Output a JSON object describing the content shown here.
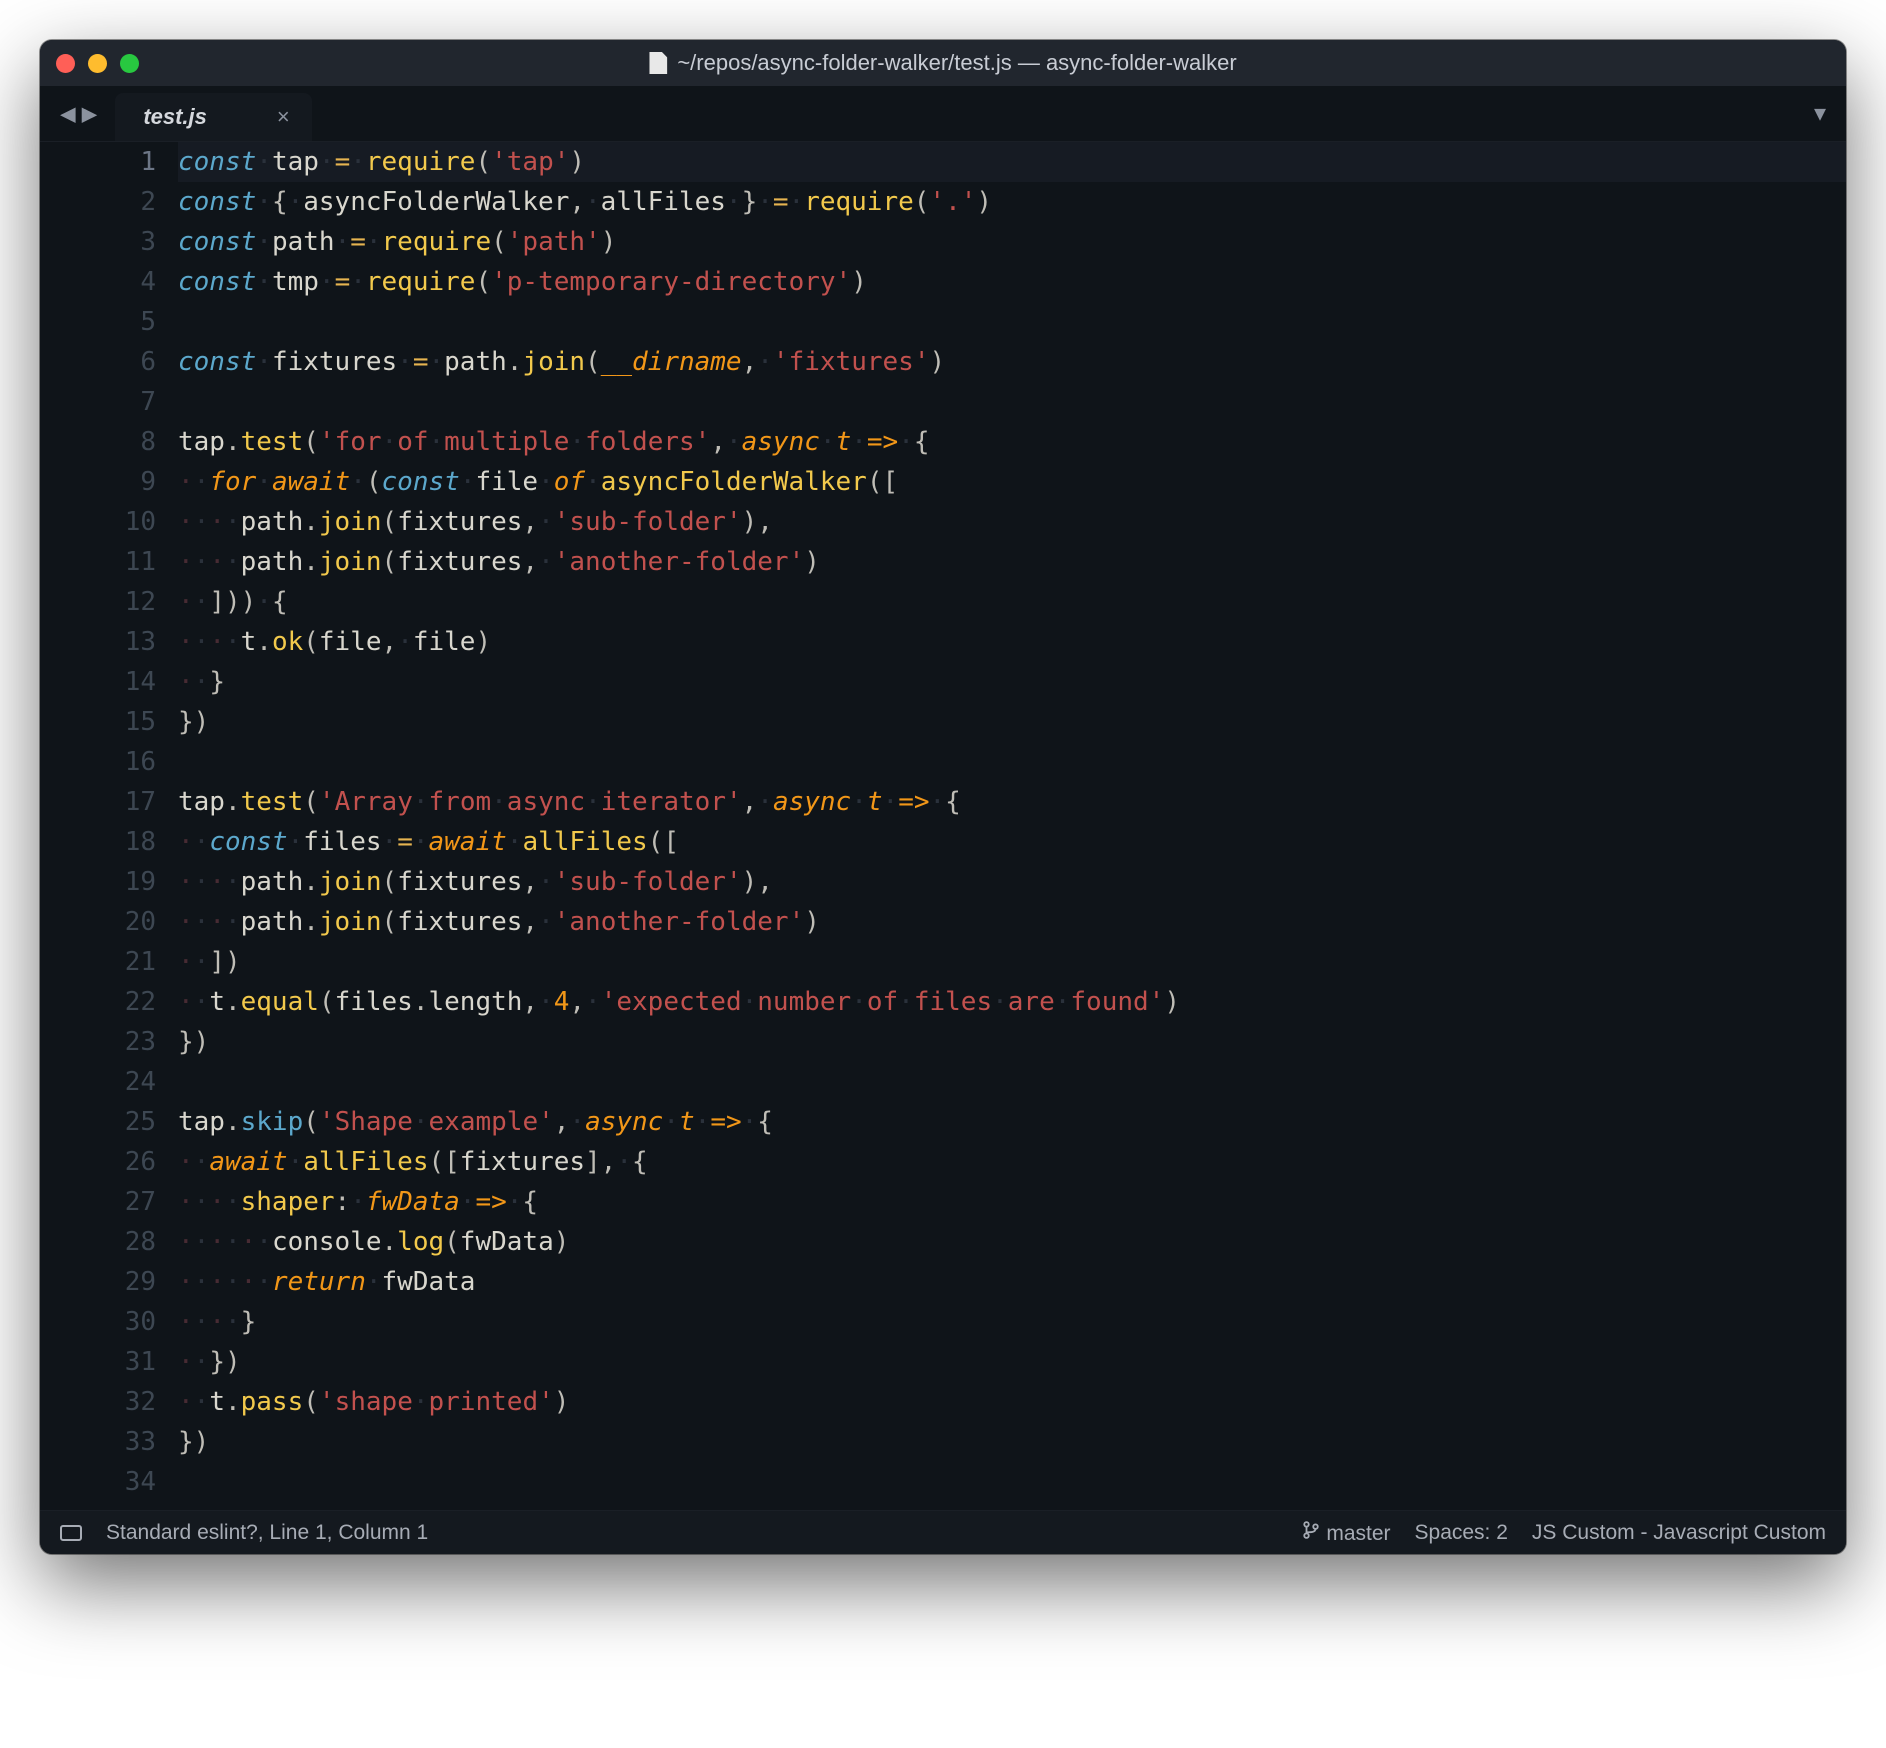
{
  "titlebar": {
    "title": "~/repos/async-folder-walker/test.js — async-folder-walker"
  },
  "tab": {
    "label": "test.js",
    "close": "×"
  },
  "nav": {
    "back": "◀",
    "forward": "▶",
    "overflow": "▼"
  },
  "code": {
    "active_line": 1,
    "lines": [
      [
        [
          "kw-decl",
          "const"
        ],
        [
          "ws",
          "·"
        ],
        [
          "ident",
          "tap"
        ],
        [
          "ws",
          "·"
        ],
        [
          "op",
          "="
        ],
        [
          "ws",
          "·"
        ],
        [
          "func",
          "require"
        ],
        [
          "punct",
          "("
        ],
        [
          "str",
          "'tap'"
        ],
        [
          "punct",
          ")"
        ]
      ],
      [
        [
          "kw-decl",
          "const"
        ],
        [
          "ws",
          "·"
        ],
        [
          "punct",
          "{"
        ],
        [
          "ws",
          "·"
        ],
        [
          "ident",
          "asyncFolderWalker"
        ],
        [
          "punct",
          ","
        ],
        [
          "ws",
          "·"
        ],
        [
          "ident",
          "allFiles"
        ],
        [
          "ws",
          "·"
        ],
        [
          "punct",
          "}"
        ],
        [
          "ws",
          "·"
        ],
        [
          "op",
          "="
        ],
        [
          "ws",
          "·"
        ],
        [
          "func",
          "require"
        ],
        [
          "punct",
          "("
        ],
        [
          "str",
          "'.'"
        ],
        [
          "punct",
          ")"
        ]
      ],
      [
        [
          "kw-decl",
          "const"
        ],
        [
          "ws",
          "·"
        ],
        [
          "ident",
          "path"
        ],
        [
          "ws",
          "·"
        ],
        [
          "op",
          "="
        ],
        [
          "ws",
          "·"
        ],
        [
          "func",
          "require"
        ],
        [
          "punct",
          "("
        ],
        [
          "str",
          "'path'"
        ],
        [
          "punct",
          ")"
        ]
      ],
      [
        [
          "kw-decl",
          "const"
        ],
        [
          "ws",
          "·"
        ],
        [
          "ident",
          "tmp"
        ],
        [
          "ws",
          "·"
        ],
        [
          "op",
          "="
        ],
        [
          "ws",
          "·"
        ],
        [
          "func",
          "require"
        ],
        [
          "punct",
          "("
        ],
        [
          "str",
          "'p-temporary-directory'"
        ],
        [
          "punct",
          ")"
        ]
      ],
      [],
      [
        [
          "kw-decl",
          "const"
        ],
        [
          "ws",
          "·"
        ],
        [
          "ident",
          "fixtures"
        ],
        [
          "ws",
          "·"
        ],
        [
          "op",
          "="
        ],
        [
          "ws",
          "·"
        ],
        [
          "ident",
          "path"
        ],
        [
          "punct",
          "."
        ],
        [
          "func",
          "join"
        ],
        [
          "punct",
          "("
        ],
        [
          "kconst",
          "__dirname"
        ],
        [
          "punct",
          ","
        ],
        [
          "ws",
          "·"
        ],
        [
          "str",
          "'fixtures'"
        ],
        [
          "punct",
          ")"
        ]
      ],
      [],
      [
        [
          "ident",
          "tap"
        ],
        [
          "punct",
          "."
        ],
        [
          "func",
          "test"
        ],
        [
          "punct",
          "("
        ],
        [
          "str",
          "'for·of·multiple·folders'"
        ],
        [
          "punct",
          ","
        ],
        [
          "ws",
          "·"
        ],
        [
          "kw-ctrl",
          "async"
        ],
        [
          "ws",
          "·"
        ],
        [
          "param",
          "t"
        ],
        [
          "ws",
          "·"
        ],
        [
          "kw-ctrl",
          "=>"
        ],
        [
          "ws",
          "·"
        ],
        [
          "punct",
          "{"
        ]
      ],
      [
        [
          "guide",
          "·"
        ],
        [
          "ws",
          "·"
        ],
        [
          "kw-ctrl",
          "for"
        ],
        [
          "ws",
          "·"
        ],
        [
          "kw-ctrl",
          "await"
        ],
        [
          "ws",
          "·"
        ],
        [
          "punct",
          "("
        ],
        [
          "kw-decl",
          "const"
        ],
        [
          "ws",
          "·"
        ],
        [
          "ident",
          "file"
        ],
        [
          "ws",
          "·"
        ],
        [
          "kw-ctrl",
          "of"
        ],
        [
          "ws",
          "·"
        ],
        [
          "func",
          "asyncFolderWalker"
        ],
        [
          "punct",
          "(["
        ]
      ],
      [
        [
          "guide",
          "·"
        ],
        [
          "ws",
          "·"
        ],
        [
          "guide",
          "·"
        ],
        [
          "ws",
          "·"
        ],
        [
          "ident",
          "path"
        ],
        [
          "punct",
          "."
        ],
        [
          "func",
          "join"
        ],
        [
          "punct",
          "("
        ],
        [
          "ident",
          "fixtures"
        ],
        [
          "punct",
          ","
        ],
        [
          "ws",
          "·"
        ],
        [
          "str",
          "'sub-folder'"
        ],
        [
          "punct",
          "),"
        ]
      ],
      [
        [
          "guide",
          "·"
        ],
        [
          "ws",
          "·"
        ],
        [
          "guide",
          "·"
        ],
        [
          "ws",
          "·"
        ],
        [
          "ident",
          "path"
        ],
        [
          "punct",
          "."
        ],
        [
          "func",
          "join"
        ],
        [
          "punct",
          "("
        ],
        [
          "ident",
          "fixtures"
        ],
        [
          "punct",
          ","
        ],
        [
          "ws",
          "·"
        ],
        [
          "str",
          "'another-folder'"
        ],
        [
          "punct",
          ")"
        ]
      ],
      [
        [
          "guide",
          "·"
        ],
        [
          "ws",
          "·"
        ],
        [
          "punct",
          "]))"
        ],
        [
          "ws",
          "·"
        ],
        [
          "punct",
          "{"
        ]
      ],
      [
        [
          "guide",
          "·"
        ],
        [
          "ws",
          "·"
        ],
        [
          "guide",
          "·"
        ],
        [
          "ws",
          "·"
        ],
        [
          "ident",
          "t"
        ],
        [
          "punct",
          "."
        ],
        [
          "func",
          "ok"
        ],
        [
          "punct",
          "("
        ],
        [
          "ident",
          "file"
        ],
        [
          "punct",
          ","
        ],
        [
          "ws",
          "·"
        ],
        [
          "ident",
          "file"
        ],
        [
          "punct",
          ")"
        ]
      ],
      [
        [
          "guide",
          "·"
        ],
        [
          "ws",
          "·"
        ],
        [
          "punct",
          "}"
        ]
      ],
      [
        [
          "punct",
          "})"
        ]
      ],
      [],
      [
        [
          "ident",
          "tap"
        ],
        [
          "punct",
          "."
        ],
        [
          "func",
          "test"
        ],
        [
          "punct",
          "("
        ],
        [
          "str",
          "'Array·from·async·iterator'"
        ],
        [
          "punct",
          ","
        ],
        [
          "ws",
          "·"
        ],
        [
          "kw-ctrl",
          "async"
        ],
        [
          "ws",
          "·"
        ],
        [
          "param",
          "t"
        ],
        [
          "ws",
          "·"
        ],
        [
          "kw-ctrl",
          "=>"
        ],
        [
          "ws",
          "·"
        ],
        [
          "punct",
          "{"
        ]
      ],
      [
        [
          "guide",
          "·"
        ],
        [
          "ws",
          "·"
        ],
        [
          "kw-decl",
          "const"
        ],
        [
          "ws",
          "·"
        ],
        [
          "ident",
          "files"
        ],
        [
          "ws",
          "·"
        ],
        [
          "op",
          "="
        ],
        [
          "ws",
          "·"
        ],
        [
          "kw-ctrl",
          "await"
        ],
        [
          "ws",
          "·"
        ],
        [
          "func",
          "allFiles"
        ],
        [
          "punct",
          "(["
        ]
      ],
      [
        [
          "guide",
          "·"
        ],
        [
          "ws",
          "·"
        ],
        [
          "guide",
          "·"
        ],
        [
          "ws",
          "·"
        ],
        [
          "ident",
          "path"
        ],
        [
          "punct",
          "."
        ],
        [
          "func",
          "join"
        ],
        [
          "punct",
          "("
        ],
        [
          "ident",
          "fixtures"
        ],
        [
          "punct",
          ","
        ],
        [
          "ws",
          "·"
        ],
        [
          "str",
          "'sub-folder'"
        ],
        [
          "punct",
          "),"
        ]
      ],
      [
        [
          "guide",
          "·"
        ],
        [
          "ws",
          "·"
        ],
        [
          "guide",
          "·"
        ],
        [
          "ws",
          "·"
        ],
        [
          "ident",
          "path"
        ],
        [
          "punct",
          "."
        ],
        [
          "func",
          "join"
        ],
        [
          "punct",
          "("
        ],
        [
          "ident",
          "fixtures"
        ],
        [
          "punct",
          ","
        ],
        [
          "ws",
          "·"
        ],
        [
          "str",
          "'another-folder'"
        ],
        [
          "punct",
          ")"
        ]
      ],
      [
        [
          "guide",
          "·"
        ],
        [
          "ws",
          "·"
        ],
        [
          "punct",
          "])"
        ]
      ],
      [
        [
          "guide",
          "·"
        ],
        [
          "ws",
          "·"
        ],
        [
          "ident",
          "t"
        ],
        [
          "punct",
          "."
        ],
        [
          "func",
          "equal"
        ],
        [
          "punct",
          "("
        ],
        [
          "ident",
          "files"
        ],
        [
          "punct",
          "."
        ],
        [
          "ident",
          "length"
        ],
        [
          "punct",
          ","
        ],
        [
          "ws",
          "·"
        ],
        [
          "num",
          "4"
        ],
        [
          "punct",
          ","
        ],
        [
          "ws",
          "·"
        ],
        [
          "str",
          "'expected·number·of·files·are·found'"
        ],
        [
          "punct",
          ")"
        ]
      ],
      [
        [
          "punct",
          "})"
        ]
      ],
      [],
      [
        [
          "ident",
          "tap"
        ],
        [
          "punct",
          "."
        ],
        [
          "func2",
          "skip"
        ],
        [
          "punct",
          "("
        ],
        [
          "str",
          "'Shape·example'"
        ],
        [
          "punct",
          ","
        ],
        [
          "ws",
          "·"
        ],
        [
          "kw-ctrl",
          "async"
        ],
        [
          "ws",
          "·"
        ],
        [
          "param",
          "t"
        ],
        [
          "ws",
          "·"
        ],
        [
          "kw-ctrl",
          "=>"
        ],
        [
          "ws",
          "·"
        ],
        [
          "punct",
          "{"
        ]
      ],
      [
        [
          "guide",
          "·"
        ],
        [
          "ws",
          "·"
        ],
        [
          "kw-ctrl",
          "await"
        ],
        [
          "ws",
          "·"
        ],
        [
          "func",
          "allFiles"
        ],
        [
          "punct",
          "(["
        ],
        [
          "ident",
          "fixtures"
        ],
        [
          "punct",
          "],"
        ],
        [
          "ws",
          "·"
        ],
        [
          "punct",
          "{"
        ]
      ],
      [
        [
          "guide",
          "·"
        ],
        [
          "ws",
          "·"
        ],
        [
          "guide",
          "·"
        ],
        [
          "ws",
          "·"
        ],
        [
          "func",
          "shaper"
        ],
        [
          "punct",
          ":"
        ],
        [
          "ws",
          "·"
        ],
        [
          "param",
          "fwData"
        ],
        [
          "ws",
          "·"
        ],
        [
          "kw-ctrl",
          "=>"
        ],
        [
          "ws",
          "·"
        ],
        [
          "punct",
          "{"
        ]
      ],
      [
        [
          "guide",
          "·"
        ],
        [
          "ws",
          "·"
        ],
        [
          "guide",
          "·"
        ],
        [
          "ws",
          "·"
        ],
        [
          "guide",
          "·"
        ],
        [
          "ws",
          "·"
        ],
        [
          "ident",
          "console"
        ],
        [
          "punct",
          "."
        ],
        [
          "func",
          "log"
        ],
        [
          "punct",
          "("
        ],
        [
          "ident",
          "fwData"
        ],
        [
          "punct",
          ")"
        ]
      ],
      [
        [
          "guide",
          "·"
        ],
        [
          "ws",
          "·"
        ],
        [
          "guide",
          "·"
        ],
        [
          "ws",
          "·"
        ],
        [
          "guide",
          "·"
        ],
        [
          "ws",
          "·"
        ],
        [
          "kw-ctrl",
          "return"
        ],
        [
          "ws",
          "·"
        ],
        [
          "ident",
          "fwData"
        ]
      ],
      [
        [
          "guide",
          "·"
        ],
        [
          "ws",
          "·"
        ],
        [
          "guide",
          "·"
        ],
        [
          "ws",
          "·"
        ],
        [
          "punct",
          "}"
        ]
      ],
      [
        [
          "guide",
          "·"
        ],
        [
          "ws",
          "·"
        ],
        [
          "punct",
          "})"
        ]
      ],
      [
        [
          "guide",
          "·"
        ],
        [
          "ws",
          "·"
        ],
        [
          "ident",
          "t"
        ],
        [
          "punct",
          "."
        ],
        [
          "func",
          "pass"
        ],
        [
          "punct",
          "("
        ],
        [
          "str",
          "'shape·printed'"
        ],
        [
          "punct",
          ")"
        ]
      ],
      [
        [
          "punct",
          "})"
        ]
      ],
      []
    ]
  },
  "statusbar": {
    "left": "Standard eslint?, Line 1, Column 1",
    "branch": "master",
    "spaces": "Spaces: 2",
    "syntax": "JS Custom - Javascript Custom"
  }
}
